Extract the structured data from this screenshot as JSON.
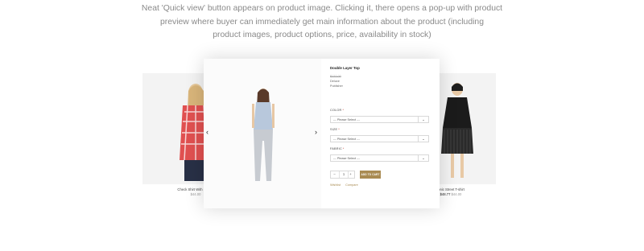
{
  "intro": {
    "line1": "Neat 'Quick view' button appears on product image. Clicking it, there opens a pop-up with product",
    "line2": "preview where buyer can immediately get main information about the product (including",
    "line3": "product images, product options, price, availability in stock)"
  },
  "background_products": {
    "left": {
      "name": "Check Shirt With Pocket",
      "price": "$44.00"
    },
    "right": {
      "name": "Ionic Street T-shirt",
      "old_price": "$48.77",
      "price": "$44.00"
    }
  },
  "popup": {
    "title": "Double Layer Top",
    "price": "$122.00",
    "brand": "Deluxe",
    "vendor": "Publisher",
    "options": [
      {
        "label": "COLOR",
        "required_mark": "*",
        "value": "--- Please Select ---"
      },
      {
        "label": "SIZE",
        "required_mark": "*",
        "value": "--- Please Select ---"
      },
      {
        "label": "FABRIC",
        "required_mark": "*",
        "value": "--- Please Select ---"
      }
    ],
    "quantity": "1",
    "qty_minus": "–",
    "qty_plus": "+",
    "add_to_cart": "ADD TO CART",
    "wishlist": "Wishlist",
    "compare": "Compare",
    "prev_arrow": "‹",
    "next_arrow": "›",
    "chevron": "⌄"
  },
  "colors": {
    "accent": "#a98b52",
    "required": "#c0392b"
  }
}
